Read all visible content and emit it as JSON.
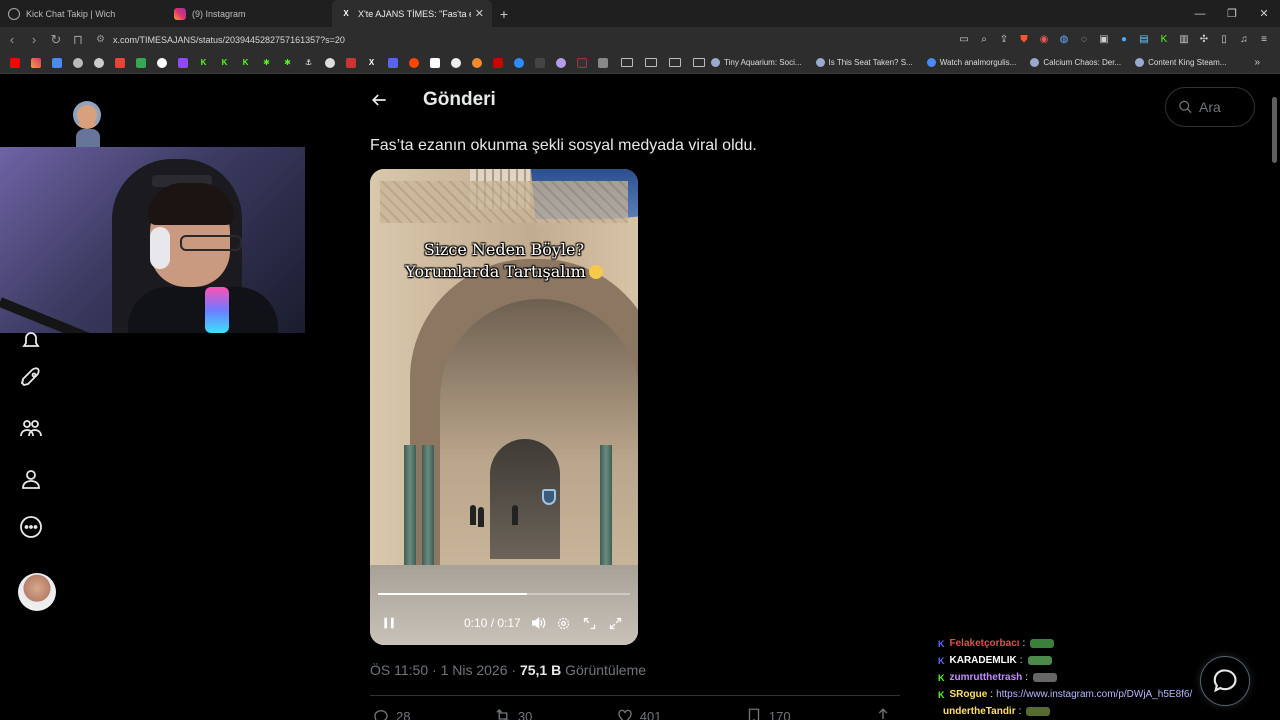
{
  "browser": {
    "tabs": [
      {
        "title": "Kick Chat Takip | Wich",
        "icon": "globe-icon"
      },
      {
        "title": "(9) Instagram",
        "icon": "instagram-icon"
      },
      {
        "title": "X'te AJANS TİMES: \"Fas'ta ez...",
        "icon": "x-logo-icon",
        "active": true
      }
    ],
    "new_tab": "+",
    "url": "x.com/TIMESAJANS/status/2039445282757161357?s=20",
    "bookmarks": [
      {
        "label": "Tiny Aquarium: Soci..."
      },
      {
        "label": "Is This Seat Taken? S..."
      },
      {
        "label": "Watch analmorgulis..."
      },
      {
        "label": "Calcium Chaos: Der..."
      },
      {
        "label": "Content King Steam..."
      }
    ]
  },
  "header": {
    "title": "Gönderi",
    "search_placeholder": "Ara"
  },
  "post": {
    "text": "Fas’ta ezanın okunma şekli sosyal medyada viral oldu.",
    "video": {
      "caption_line1": "Sizce Neden Böyle?",
      "caption_line2": "Yorumlarda Tartışalım",
      "time": "0:10 / 0:17",
      "progress": 0.59
    },
    "meta": {
      "time": "ÖS 11:50",
      "sep1": " · ",
      "date": "1 Nis 2026",
      "sep2": " · ",
      "views": "75,1 B",
      "views_label": " Görüntüleme"
    },
    "actions": {
      "replies": "28",
      "reposts": "30",
      "likes": "401",
      "bookmarks": "170"
    }
  },
  "chat": [
    {
      "badge": "K",
      "user": "Felaketçorbacı",
      "user_color": "#e05050",
      "badge_color": "#5b6cff",
      "emote_color": "#3a7f3a"
    },
    {
      "badge": "K",
      "user": "KARADEMLIK",
      "user_color": "#ffffff",
      "badge_color": "#5b6cff",
      "emote_color": "#4c8a4c"
    },
    {
      "badge": "K",
      "user": "zumrutthetrash",
      "user_color": "#c58cff",
      "badge_color": "#53fc18",
      "emote_color": "#666"
    },
    {
      "badge": "K",
      "user": "SRogue",
      "user_color": "#ffe066",
      "badge_color": "#53fc18",
      "msg": "https://www.instagram.com/p/DWjA_h5E8f6/"
    },
    {
      "badge": "",
      "user": "undertheTandir",
      "user_color": "#ffe066",
      "badge_color": "#53fc18",
      "emote_color": "#556b2f"
    }
  ],
  "colors": {
    "background": "#000000",
    "text_primary": "#e7e9ea",
    "text_secondary": "#71767b",
    "border": "#2f3336",
    "kick_green": "#53fc18"
  }
}
